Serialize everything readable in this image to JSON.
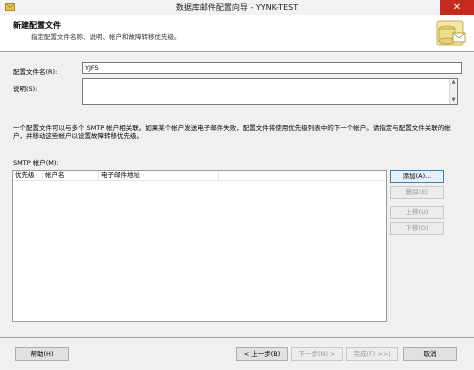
{
  "window": {
    "title": "数据库邮件配置向导 - YYNK-TEST",
    "close_glyph": "✕"
  },
  "header": {
    "title": "新建配置文件",
    "subtitle": "指定配置文件名称、说明、帐户和故障转移优先级。"
  },
  "form": {
    "profile_name_label": "配置文件名(R):",
    "profile_name_value": "YJFS",
    "description_label": "说明(S):",
    "description_value": ""
  },
  "info": {
    "text": "一个配置文件可以与多个 SMTP 帐户相关联。如果某个帐户发送电子邮件失败，配置文件将使用优先级列表中的下一个帐户。请指定与配置文件关联的帐户，并移动这些帐户以设置故障转移优先级。"
  },
  "smtp": {
    "label": "SMTP 帐户(M):",
    "columns": [
      "优先级",
      "帐户名",
      "电子邮件地址"
    ],
    "rows": []
  },
  "side_buttons": {
    "add": "添加(A)...",
    "delete": "删除(E)",
    "up": "上移(U)",
    "down": "下移(O)"
  },
  "footer": {
    "help": "帮助(H)",
    "back": "< 上一步(B)",
    "next": "下一步(N) >",
    "finish": "完成(F) >>|",
    "cancel": "取消"
  },
  "colors": {
    "close_red": "#c42b1c",
    "dialog_bg": "#f0f0f0",
    "default_button_border": "#3c7fb1"
  },
  "icons": {
    "app": "mail-wizard-icon",
    "header_art": "database-mail-art"
  }
}
